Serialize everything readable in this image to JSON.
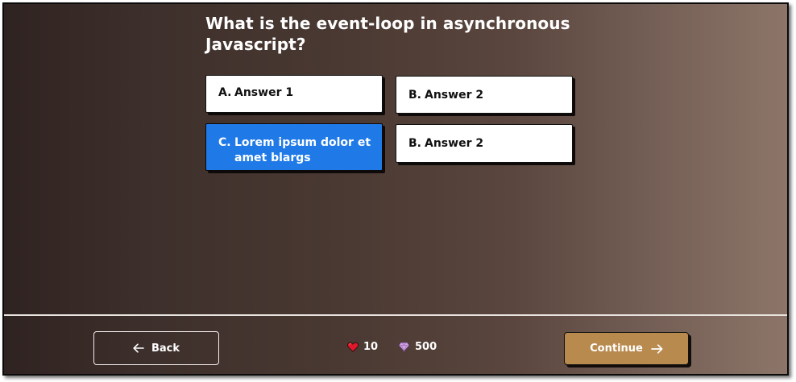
{
  "question": {
    "line1": "What is the event-loop in asynchronous",
    "line2": "Javascript?"
  },
  "answers": [
    {
      "letter": "A.",
      "text": "Answer 1",
      "selected": false
    },
    {
      "letter": "B.",
      "text": "Answer 2",
      "selected": false
    },
    {
      "letter": "C.",
      "text": "Lorem ipsum dolor et amet blargs",
      "selected": true
    },
    {
      "letter": "B.",
      "text": "Answer 2",
      "selected": false
    }
  ],
  "footer": {
    "back_label": "Back",
    "continue_label": "Continue",
    "lives": "10",
    "gems": "500"
  },
  "icons": {
    "back": "arrow-left-icon",
    "continue": "arrow-right-icon",
    "lives": "heart-icon",
    "gems": "diamond-icon"
  },
  "colors": {
    "selected_answer": "#1f7ae8",
    "continue_button": "#b98a4e",
    "heart": "#e0182b",
    "gem": "#d3a3e6"
  }
}
